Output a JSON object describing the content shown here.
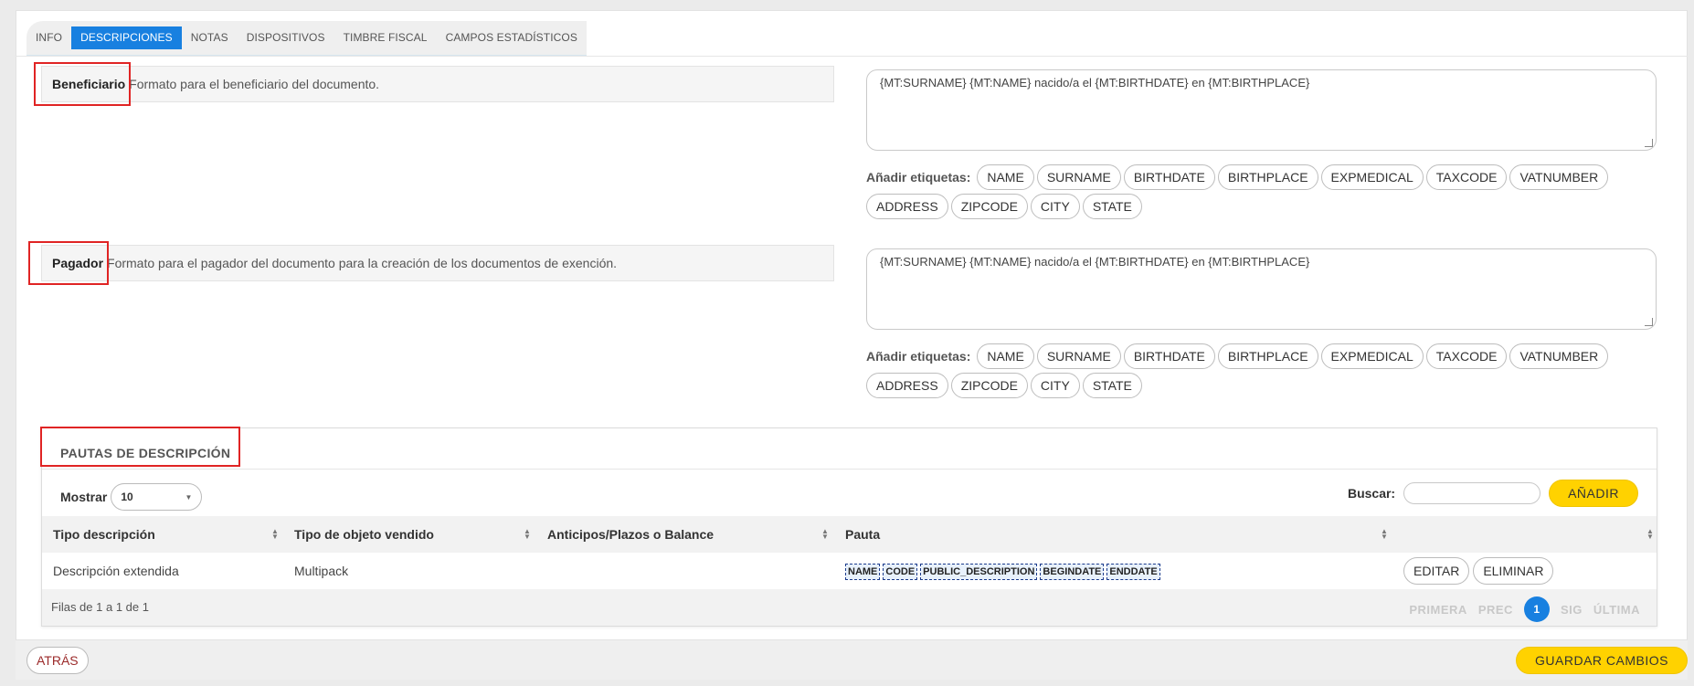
{
  "tabs": [
    {
      "label": "INFO",
      "active": false
    },
    {
      "label": "DESCRIPCIONES",
      "active": true
    },
    {
      "label": "NOTAS",
      "active": false
    },
    {
      "label": "DISPOSITIVOS",
      "active": false
    },
    {
      "label": "TIMBRE FISCAL",
      "active": false
    },
    {
      "label": "CAMPOS ESTADÍSTICOS",
      "active": false
    }
  ],
  "beneficiario": {
    "title": "Beneficiario",
    "description": "Formato para el beneficiario del documento.",
    "value": "{MT:SURNAME} {MT:NAME} nacido/a el {MT:BIRTHDATE} en {MT:BIRTHPLACE}",
    "tags_label": "Añadir etiquetas:",
    "tags": [
      "NAME",
      "SURNAME",
      "BIRTHDATE",
      "BIRTHPLACE",
      "EXPMEDICAL",
      "TAXCODE",
      "VATNUMBER",
      "ADDRESS",
      "ZIPCODE",
      "CITY",
      "STATE"
    ]
  },
  "pagador": {
    "title": "Pagador",
    "description": "Formato para el pagador del documento para la creación de los documentos de exención.",
    "value": "{MT:SURNAME} {MT:NAME} nacido/a el {MT:BIRTHDATE} en {MT:BIRTHPLACE}",
    "tags_label": "Añadir etiquetas:",
    "tags": [
      "NAME",
      "SURNAME",
      "BIRTHDATE",
      "BIRTHPLACE",
      "EXPMEDICAL",
      "TAXCODE",
      "VATNUMBER",
      "ADDRESS",
      "ZIPCODE",
      "CITY",
      "STATE"
    ]
  },
  "pautas": {
    "title": "PAUTAS DE DESCRIPCIÓN",
    "show_label": "Mostrar",
    "page_size": "10",
    "search_label": "Buscar:",
    "search_value": "",
    "add_label": "AÑADIR",
    "columns": [
      "Tipo descripción",
      "Tipo de objeto vendido",
      "Anticipos/Plazos o Balance",
      "Pauta",
      ""
    ],
    "rows": [
      {
        "tipo_descripcion": "Descripción extendida",
        "tipo_objeto": "Multipack",
        "anticipos": "",
        "pauta": [
          "NAME",
          "CODE",
          "PUBLIC_DESCRIPTION",
          "BEGINDATE",
          "ENDDATE"
        ],
        "edit_label": "EDITAR",
        "delete_label": "ELIMINAR"
      }
    ],
    "rows_info": "Filas de 1 a 1 de 1",
    "pager": {
      "first": "PRIMERA",
      "prev": "PREC",
      "current": "1",
      "next": "SIG",
      "last": "ÚLTIMA"
    }
  },
  "footer": {
    "back_label": "ATRÁS",
    "save_label": "GUARDAR CAMBIOS"
  },
  "colors": {
    "accent": "#1880e0",
    "highlight": "#e02424",
    "primary_button": "#ffd200"
  }
}
